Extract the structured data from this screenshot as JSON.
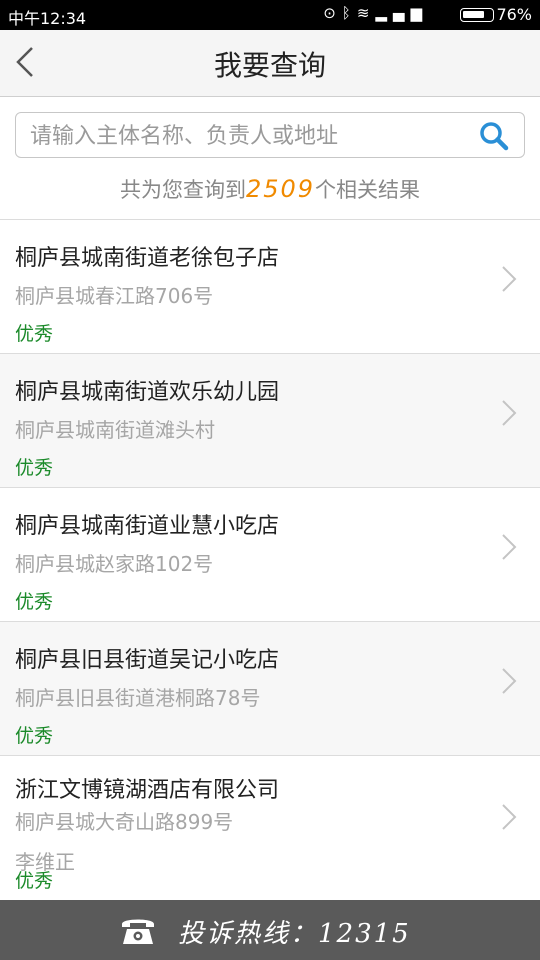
{
  "status_bar": {
    "time": "中午12:34",
    "battery_percent": "76%",
    "battery_level": 0.76,
    "icons": [
      "alarm-icon",
      "bluetooth-icon",
      "wifi-icon",
      "data-icon",
      "signal-icon",
      "battery-icon"
    ]
  },
  "header": {
    "title": "我要查询",
    "back_icon": "chevron-left-icon"
  },
  "search": {
    "placeholder": "请输入主体名称、负责人或地址",
    "value": "",
    "icon": "search-icon"
  },
  "summary": {
    "prefix": "共为您查询到",
    "count": "2509",
    "suffix": "个相关结果"
  },
  "results": [
    {
      "name": "桐庐县城南街道老徐包子店",
      "address": "桐庐县城春江路706号",
      "rating": "优秀"
    },
    {
      "name": "桐庐县城南街道欢乐幼儿园",
      "address": "桐庐县城南街道滩头村",
      "rating": "优秀"
    },
    {
      "name": "桐庐县城南街道业慧小吃店",
      "address": "桐庐县城赵家路102号",
      "rating": "优秀"
    },
    {
      "name": "桐庐县旧县街道吴记小吃店",
      "address": "桐庐县旧县街道港桐路78号",
      "rating": "优秀"
    },
    {
      "name": "浙江文博镜湖酒店有限公司",
      "address": "桐庐县城大奇山路899号",
      "person": "李维正",
      "rating": "优秀"
    }
  ],
  "footer": {
    "hotline": "投诉热线：12315",
    "icon": "phone-icon"
  },
  "colors": {
    "accent_orange": "#f08a00",
    "rating_green": "#1b8a2a",
    "search_blue": "#2a8fd6",
    "footer_bg": "#5a5a5a"
  }
}
